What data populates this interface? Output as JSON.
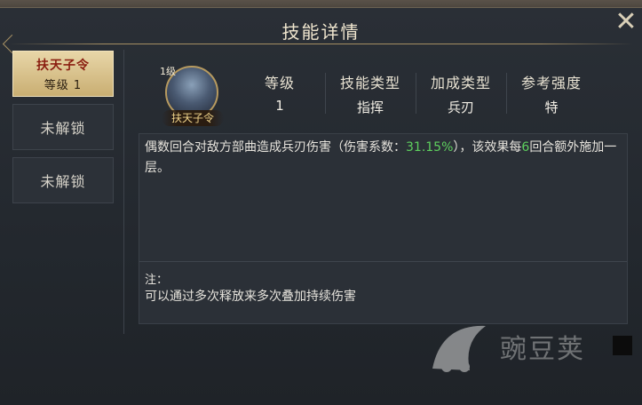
{
  "window": {
    "title": "技能详情"
  },
  "sidebar": {
    "items": [
      {
        "name": "扶天子令",
        "level": "等级 1",
        "active": true
      },
      {
        "label": "未解锁"
      },
      {
        "label": "未解锁"
      }
    ]
  },
  "skill": {
    "avatar_level": "1级",
    "avatar_name": "扶天子令",
    "stats": [
      {
        "key": "等级",
        "value": "1"
      },
      {
        "key": "技能类型",
        "value": "指挥"
      },
      {
        "key": "加成类型",
        "value": "兵刃"
      },
      {
        "key": "参考强度",
        "value": "特"
      }
    ],
    "description": {
      "part1": "偶数回合对敌方部曲造成兵刃伤害（伤害系数：",
      "coef": "31.15%",
      "part2": "），该效果每",
      "rounds": "6",
      "part3": "回合额外施加一层。"
    },
    "note_title": "注：",
    "note_text": "可以通过多次释放来多次叠加持续伤害"
  },
  "watermark": {
    "text": "豌豆荚"
  },
  "colors": {
    "highlight": "#5ed05e",
    "accent": "#c9ae72"
  },
  "icons": {
    "close": "close-icon"
  }
}
